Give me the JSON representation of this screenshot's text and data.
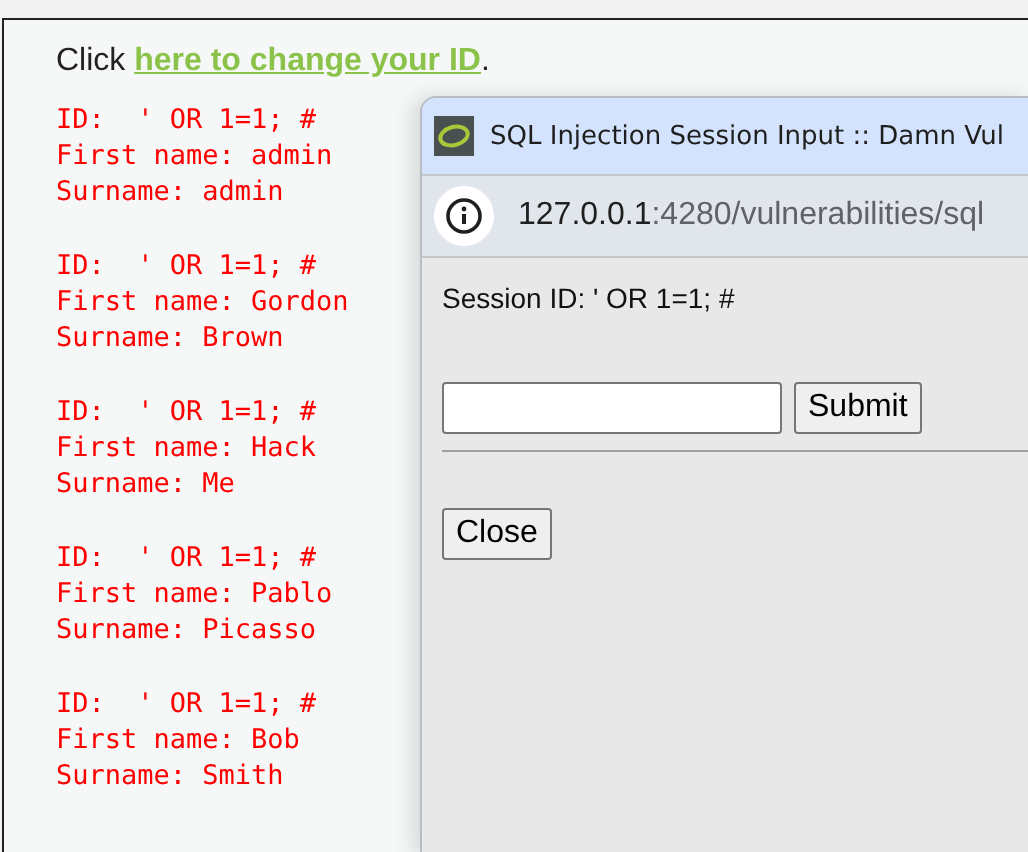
{
  "intro": {
    "prefix": "Click ",
    "link": "here to change your ID",
    "suffix": "."
  },
  "results": [
    {
      "id": "ID:  ' OR 1=1; #",
      "first": "First name: admin",
      "surname": "Surname: admin"
    },
    {
      "id": "ID:  ' OR 1=1; #",
      "first": "First name: Gordon",
      "surname": "Surname: Brown"
    },
    {
      "id": "ID:  ' OR 1=1; #",
      "first": "First name: Hack",
      "surname": "Surname: Me"
    },
    {
      "id": "ID:  ' OR 1=1; #",
      "first": "First name: Pablo",
      "surname": "Surname: Picasso"
    },
    {
      "id": "ID:  ' OR 1=1; #",
      "first": "First name: Bob",
      "surname": "Surname: Smith"
    }
  ],
  "popup": {
    "title": "SQL Injection Session Input :: Damn Vul",
    "url_host": "127.0.0.1",
    "url_path": ":4280/vulnerabilities/sql",
    "session_text": "Session ID: ' OR 1=1; #",
    "submit": "Submit",
    "close": "Close"
  }
}
